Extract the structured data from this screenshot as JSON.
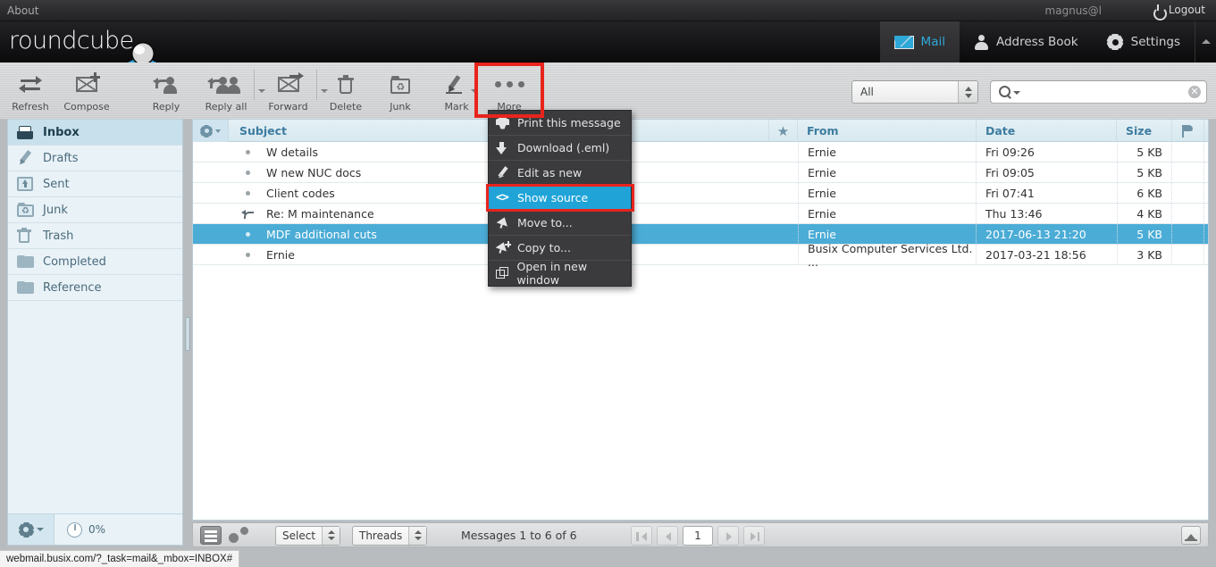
{
  "topbar": {
    "about_label": "About",
    "user_email": "magnus@l",
    "logout_label": "Logout"
  },
  "header": {
    "logo_text": "roundcube",
    "tasks": [
      {
        "label": "Mail",
        "icon": "mail-icon",
        "selected": true
      },
      {
        "label": "Address Book",
        "icon": "person-icon",
        "selected": false
      },
      {
        "label": "Settings",
        "icon": "gear-icon",
        "selected": false
      }
    ]
  },
  "toolbar": {
    "buttons": [
      {
        "label": "Refresh",
        "icon": "refresh-icon"
      },
      {
        "label": "Compose",
        "icon": "compose-icon"
      },
      {
        "label": "Reply",
        "icon": "reply-icon"
      },
      {
        "label": "Reply all",
        "icon": "reply-all-icon"
      },
      {
        "label": "Forward",
        "icon": "forward-icon"
      },
      {
        "label": "Delete",
        "icon": "trash-icon"
      },
      {
        "label": "Junk",
        "icon": "junk-icon"
      },
      {
        "label": "Mark",
        "icon": "marker-icon"
      },
      {
        "label": "More",
        "icon": "more-dots-icon"
      }
    ]
  },
  "search": {
    "scope_value": "All",
    "input_value": "",
    "placeholder": ""
  },
  "more_menu": {
    "items": [
      {
        "label": "Print this message",
        "icon": "printer-icon",
        "highlighted": false
      },
      {
        "label": "Download (.eml)",
        "icon": "download-icon",
        "highlighted": false
      },
      {
        "label": "Edit as new",
        "icon": "pencil-icon",
        "highlighted": false
      },
      {
        "label": "Show source",
        "icon": "code-icon",
        "highlighted": true
      },
      {
        "label": "Move to...",
        "icon": "move-arrow-icon",
        "highlighted": false
      },
      {
        "label": "Copy to...",
        "icon": "copy-arrow-icon",
        "highlighted": false
      },
      {
        "label": "Open in new window",
        "icon": "new-window-icon",
        "highlighted": false
      }
    ]
  },
  "sidebar": {
    "folders": [
      {
        "label": "Inbox",
        "icon": "inbox-icon",
        "selected": true
      },
      {
        "label": "Drafts",
        "icon": "drafts-pencil-icon",
        "selected": false
      },
      {
        "label": "Sent",
        "icon": "sent-icon",
        "selected": false
      },
      {
        "label": "Junk",
        "icon": "junk-recycle-icon",
        "selected": false
      },
      {
        "label": "Trash",
        "icon": "trash-icon",
        "selected": false
      },
      {
        "label": "Completed",
        "icon": "folder-icon",
        "selected": false
      },
      {
        "label": "Reference",
        "icon": "folder-icon",
        "selected": false
      }
    ],
    "quota_label": "0%"
  },
  "messagelist": {
    "columns": {
      "subject": "Subject",
      "from": "From",
      "date": "Date",
      "size": "Size",
      "star": "star-icon",
      "flag": "flag-icon",
      "attachment": "paperclip-icon"
    },
    "rows": [
      {
        "status": "unread-dot",
        "subject": "W                          details",
        "from": "Ernie",
        "date": "Fri 09:26",
        "size": "5 KB",
        "selected": false
      },
      {
        "status": "unread-dot",
        "subject": "W            new        NUC docs",
        "from": "Ernie",
        "date": "Fri 09:05",
        "size": "5 KB",
        "selected": false
      },
      {
        "status": "unread-dot",
        "subject": "Client codes",
        "from": "Ernie",
        "date": "Fri 07:41",
        "size": "6 KB",
        "selected": false
      },
      {
        "status": "replied-arrow",
        "subject": "Re: M              maintenance",
        "from": "Ernie",
        "date": "Thu 13:46",
        "size": "4 KB",
        "selected": false
      },
      {
        "status": "unread-dot",
        "subject": "MDF additional cuts",
        "from": "Ernie",
        "date": "2017-06-13 21:20",
        "size": "5 KB",
        "selected": true
      },
      {
        "status": "unread-dot",
        "subject": "Ernie",
        "from": "Busix Computer Services Ltd. ...",
        "date": "2017-03-21 18:56",
        "size": "3 KB",
        "selected": false
      }
    ]
  },
  "listfooter": {
    "select_label": "Select",
    "threads_label": "Threads",
    "count_label": "Messages 1 to 6 of 6",
    "page_value": "1"
  },
  "statusbar": {
    "url": "webmail.busix.com/?_task=mail&_mbox=INBOX#"
  },
  "colors": {
    "accent_blue": "#4bacd6",
    "menu_highlight": "#20a4d8",
    "redbox": "#e8241c",
    "sidebar_bg": "#e9f2f7"
  }
}
